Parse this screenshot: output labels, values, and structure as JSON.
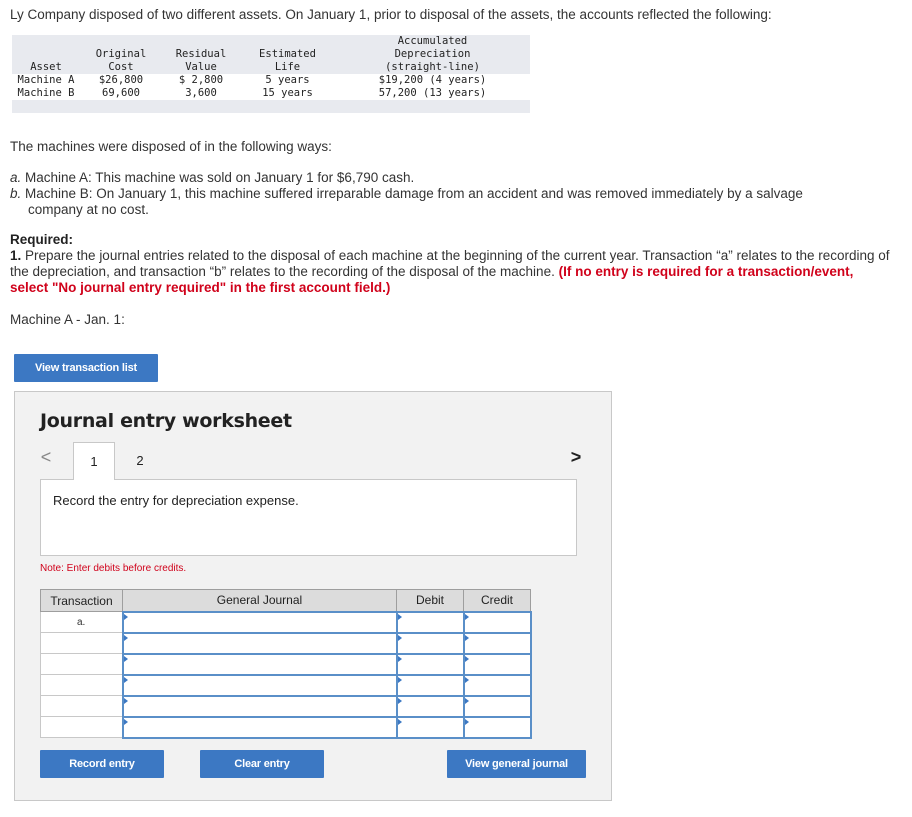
{
  "intro": "Ly Company disposed of two different assets. On January 1, prior to disposal of the assets, the accounts reflected the following:",
  "asset_table": {
    "headers": {
      "asset": [
        "",
        "",
        "Asset"
      ],
      "cost": [
        "",
        "Original",
        "Cost"
      ],
      "residual": [
        "",
        "Residual",
        "Value"
      ],
      "life": [
        "",
        "Estimated",
        "Life"
      ],
      "accum": [
        "Accumulated",
        "Depreciation",
        "(straight-line)"
      ]
    },
    "rows": [
      {
        "asset": "Machine A",
        "cost": "$26,800",
        "residual": "$ 2,800",
        "life": "5 years",
        "accum": "$19,200 (4 years)"
      },
      {
        "asset": "Machine B",
        "cost": "69,600",
        "residual": "3,600",
        "life": "15 years",
        "accum": "57,200 (13 years)"
      }
    ]
  },
  "disposed_intro": "The machines were disposed of in the following ways:",
  "items": [
    {
      "label": "a.",
      "text": " Machine A: This machine was sold on January 1 for $6,790 cash."
    },
    {
      "label": "b.",
      "text": " Machine B: On January 1, this machine suffered irreparable damage from an accident and was removed immediately by a salvage",
      "cont": "company at no cost."
    }
  ],
  "required": {
    "heading": "Required:",
    "num": "1.",
    "text": " Prepare the journal entries related to the disposal of each machine at the beginning of the current year. Transaction “a” relates to the recording of the depreciation, and transaction “b” relates to the recording of the disposal of the machine. ",
    "red": "(If no entry is required for a transaction/event, select \"No journal entry required\" in the first account field.)"
  },
  "machine_label": "Machine A - Jan. 1:",
  "buttons": {
    "view_transaction_list": "View transaction list",
    "record_entry": "Record entry",
    "clear_entry": "Clear entry",
    "view_general_journal": "View general journal"
  },
  "worksheet": {
    "title": "Journal entry worksheet",
    "prev_icon": "<",
    "next_icon": ">",
    "tabs": [
      "1",
      "2"
    ],
    "active_tab": "1",
    "instruction": "Record the entry for depreciation expense.",
    "note": "Note: Enter debits before credits.",
    "columns": [
      "Transaction",
      "General Journal",
      "Debit",
      "Credit"
    ],
    "rows": [
      {
        "transaction": "a.",
        "account": "",
        "debit": "",
        "credit": ""
      },
      {
        "transaction": "",
        "account": "",
        "debit": "",
        "credit": ""
      },
      {
        "transaction": "",
        "account": "",
        "debit": "",
        "credit": ""
      },
      {
        "transaction": "",
        "account": "",
        "debit": "",
        "credit": ""
      },
      {
        "transaction": "",
        "account": "",
        "debit": "",
        "credit": ""
      },
      {
        "transaction": "",
        "account": "",
        "debit": "",
        "credit": ""
      }
    ]
  },
  "colors": {
    "button_blue": "#3c78c3",
    "warning_red": "#d0021b",
    "input_border_blue": "#5a8fc8"
  }
}
